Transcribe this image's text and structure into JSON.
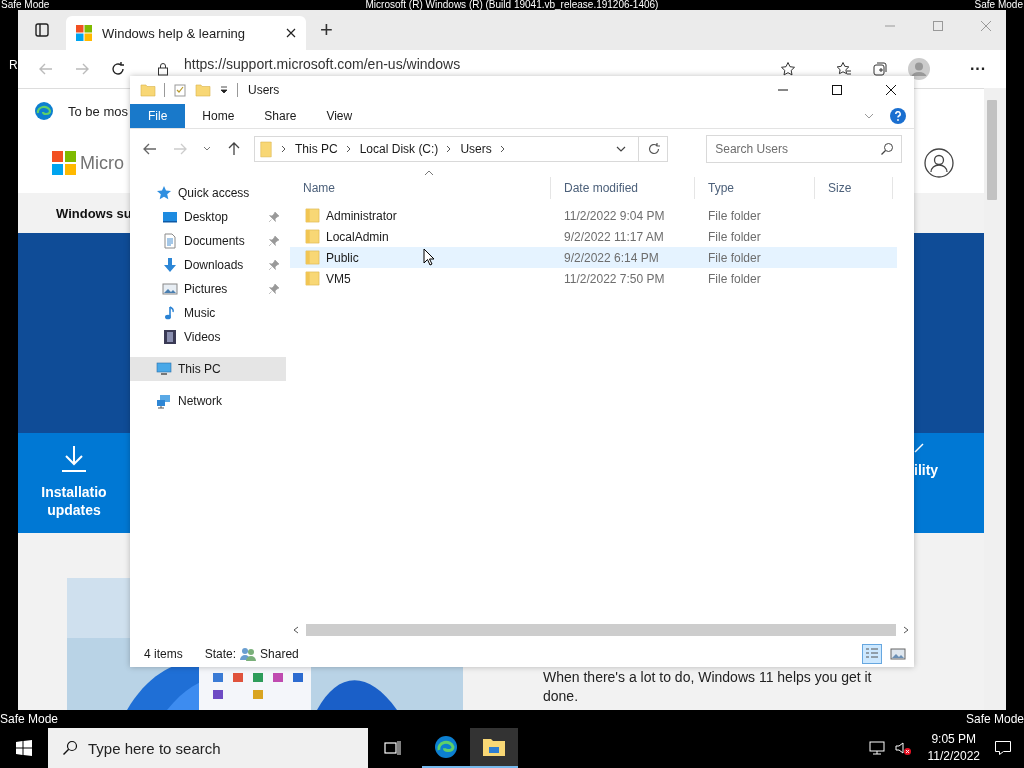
{
  "desktop": {
    "top_left": "Safe Mode",
    "top_center": "Microsoft (R) Windows (R) (Build 19041.vb_release.191206-1406)",
    "top_right": "Safe Mode",
    "left_fragment": "R",
    "bottom_left": "Safe Mode",
    "bottom_right": "Safe Mode"
  },
  "browser": {
    "tabs": [
      {
        "label": "Windows help & learning",
        "selected": true
      }
    ],
    "new_tab": "+",
    "address": "https://support.microsoft.com/en-us/windows",
    "more": "···",
    "info_bar": "To be mos",
    "logo_text": "Micro",
    "nav_title": "Windows su",
    "tile_left": {
      "line1": "Installatio",
      "line2": "updates"
    },
    "tile_right": "ility",
    "promo_text": "When there's a lot to do, Windows 11 helps you get it done."
  },
  "explorer": {
    "title": "Users",
    "ribbon_tabs": [
      {
        "label": "File",
        "selected": true
      },
      {
        "label": "Home",
        "selected": false
      },
      {
        "label": "Share",
        "selected": false
      },
      {
        "label": "View",
        "selected": false
      }
    ],
    "breadcrumbs": [
      "This PC",
      "Local Disk (C:)",
      "Users"
    ],
    "search": {
      "placeholder": "Search Users"
    },
    "nav": [
      {
        "label": "Quick access",
        "kind": "star",
        "selected": false,
        "children": [
          {
            "label": "Desktop",
            "kind": "desktop",
            "pinned": true,
            "selected": false
          },
          {
            "label": "Documents",
            "kind": "documents",
            "pinned": true,
            "selected": false
          },
          {
            "label": "Downloads",
            "kind": "downloads",
            "pinned": true,
            "selected": false
          },
          {
            "label": "Pictures",
            "kind": "pictures",
            "pinned": true,
            "selected": false
          },
          {
            "label": "Music",
            "kind": "music",
            "pinned": false,
            "selected": false
          },
          {
            "label": "Videos",
            "kind": "videos",
            "pinned": false,
            "selected": false
          }
        ]
      },
      {
        "label": "This PC",
        "kind": "pc",
        "selected": true
      },
      {
        "label": "Network",
        "kind": "network",
        "selected": false
      }
    ],
    "columns": [
      "Name",
      "Date modified",
      "Type",
      "Size"
    ],
    "rows": [
      {
        "name": "Administrator",
        "date": "11/2/2022 9:04 PM",
        "type": "File folder",
        "hovered": false
      },
      {
        "name": "LocalAdmin",
        "date": "9/2/2022 11:17 AM",
        "type": "File folder",
        "hovered": false
      },
      {
        "name": "Public",
        "date": "9/2/2022 6:14 PM",
        "type": "File folder",
        "hovered": true
      },
      {
        "name": "VM5",
        "date": "11/2/2022 7:50 PM",
        "type": "File folder",
        "hovered": false
      }
    ],
    "status": {
      "count": "4 items",
      "state_label": "State:",
      "state": "Shared"
    }
  },
  "taskbar": {
    "search": {
      "placeholder": "Type here to search"
    },
    "apps": [
      {
        "kind": "edge",
        "active": false
      },
      {
        "kind": "explorer",
        "active": true
      }
    ],
    "time": "9:05 PM",
    "date": "11/2/2022"
  }
}
